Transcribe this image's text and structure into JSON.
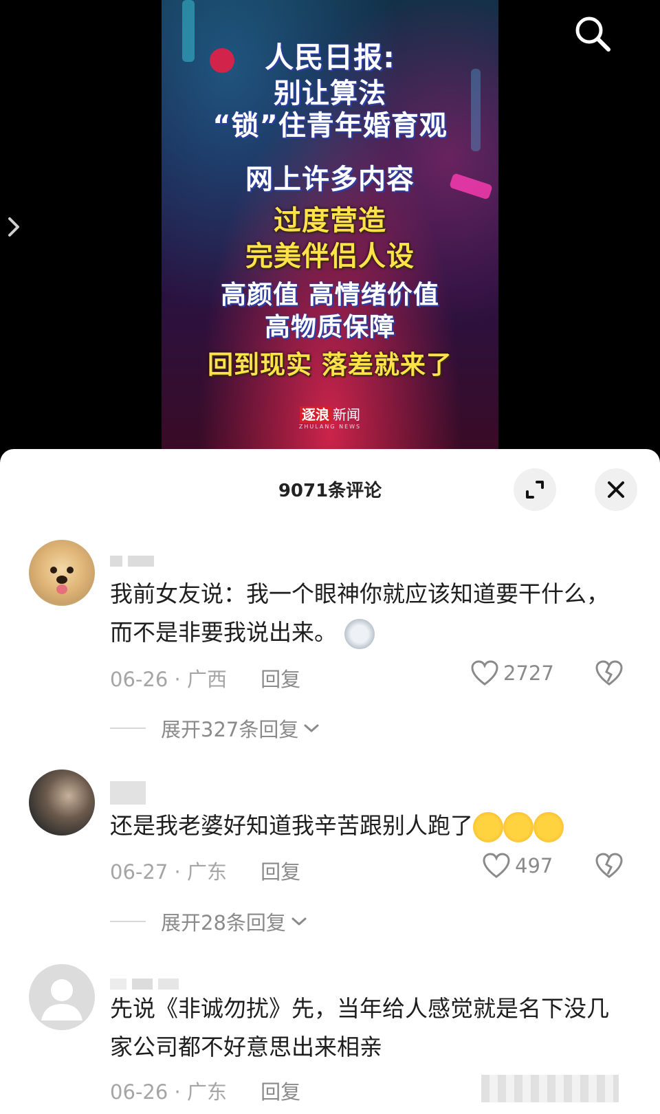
{
  "video": {
    "headline_lines": [
      "人民日报:",
      "别让算法",
      "“锁”住青年婚育观",
      "网上许多内容",
      "过度营造",
      "完美伴侣人设",
      "高颜值 高情绪价值",
      "高物质保障",
      "回到现实 落差就来了"
    ],
    "watermark_brand": "逐浪",
    "watermark_text": "新闻",
    "watermark_sub": "ZHULANG NEWS"
  },
  "comments_sheet": {
    "title": "9071条评论",
    "comments": [
      {
        "text": "我前女友说：我一个眼神你就应该知道要干什么，而不是非要我说出来。",
        "date": "06-26",
        "location": "广西",
        "reply_label": "回复",
        "likes": "2727",
        "expand_label": "展开327条回复"
      },
      {
        "text": "还是我老婆好知道我辛苦跟别人跑了",
        "date": "06-27",
        "location": "广东",
        "reply_label": "回复",
        "likes": "497",
        "expand_label": "展开28条回复"
      },
      {
        "text": "先说《非诚勿扰》先，当年给人感觉就是名下没几家公司都不好意思出来相亲",
        "date": "06-26",
        "location": "广东",
        "reply_label": "回复"
      }
    ]
  },
  "colors": {
    "headline_white": "#ffffff",
    "headline_yellow": "#ffe14a",
    "meta_gray": "#a5a5a5",
    "text_dark": "#1e1e1e"
  }
}
